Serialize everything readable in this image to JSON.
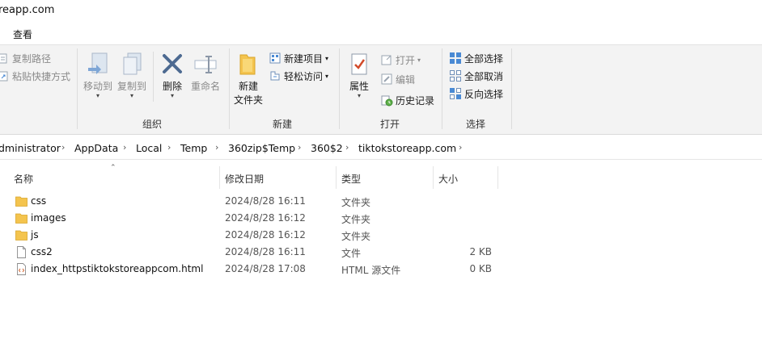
{
  "window": {
    "title": "reapp.com"
  },
  "tabs": [
    {
      "label": "查看"
    }
  ],
  "ribbon": {
    "clipboard": {
      "copy_path": "复制路径",
      "paste_shortcut": "粘贴快捷方式"
    },
    "organize": {
      "label": "组织",
      "move_to": "移动到",
      "copy_to": "复制到",
      "delete": "删除",
      "rename": "重命名"
    },
    "new": {
      "label": "新建",
      "new_item": "新建项目",
      "easy_access": "轻松访问",
      "new_folder_line1": "新建",
      "new_folder_line2": "文件夹"
    },
    "open": {
      "label": "打开",
      "properties": "属性",
      "open": "打开",
      "edit": "编辑",
      "history": "历史记录"
    },
    "select": {
      "label": "选择",
      "select_all": "全部选择",
      "select_none": "全部取消",
      "invert": "反向选择"
    }
  },
  "address": {
    "crumbs": [
      "dministrator",
      "AppData",
      "Local",
      "Temp",
      "360zip$Temp",
      "360$2",
      "tiktokstoreapp.com"
    ]
  },
  "columns": {
    "name": "名称",
    "date": "修改日期",
    "type": "类型",
    "size": "大小"
  },
  "files": [
    {
      "name": "css",
      "date": "2024/8/28 16:11",
      "type": "文件夹",
      "size": "",
      "icon": "folder-icon"
    },
    {
      "name": "images",
      "date": "2024/8/28 16:12",
      "type": "文件夹",
      "size": "",
      "icon": "folder-icon"
    },
    {
      "name": "js",
      "date": "2024/8/28 16:12",
      "type": "文件夹",
      "size": "",
      "icon": "folder-icon"
    },
    {
      "name": "css2",
      "date": "2024/8/28 16:11",
      "type": "文件",
      "size": "2 KB",
      "icon": "file-icon"
    },
    {
      "name": "index_httpstiktokstoreappcom.html",
      "date": "2024/8/28 17:08",
      "type": "HTML 源文件",
      "size": "0 KB",
      "icon": "html-file-icon"
    }
  ],
  "colors": {
    "folder": "#f4c44e",
    "accent": "#1e6fd1",
    "ribbon_bg": "#f3f3f3"
  }
}
